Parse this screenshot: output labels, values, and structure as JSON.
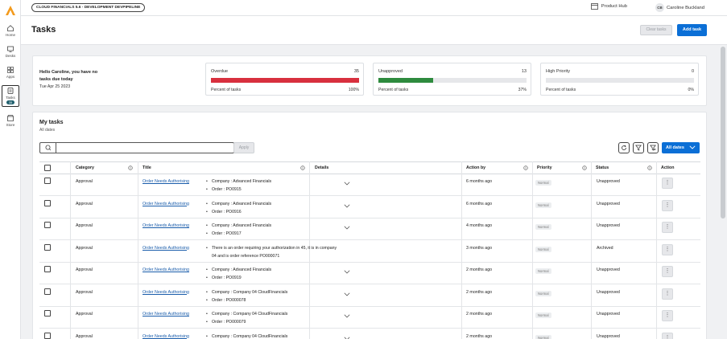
{
  "app": {
    "environment": "CLOUD FINANCIALS 5.6 - DEVELOPMENT DEVPIPELINE",
    "product_hub": "Product Hub",
    "user_initials": "CB",
    "user_name": "Caroline Buckland"
  },
  "rail": {
    "items": [
      {
        "label": "Home",
        "icon": "home-icon"
      },
      {
        "label": "Desks",
        "icon": "desk-icon"
      },
      {
        "label": "Apps",
        "icon": "apps-icon"
      },
      {
        "label": "Tasks",
        "icon": "tasks-icon",
        "badge": "35",
        "active": true
      },
      {
        "label": "Store",
        "icon": "store-icon"
      }
    ]
  },
  "header": {
    "title": "Tasks",
    "clear_tasks": "Clear tasks",
    "add_task": "Add task"
  },
  "summary": {
    "greeting": "Hello Caroline, you have no tasks due today",
    "date": "Tue Apr 25 2023",
    "stats": [
      {
        "label": "Overdue",
        "count": "35",
        "percent_label": "Percent of tasks",
        "percent": "100%",
        "fraction": 1.0,
        "color": "#d8303e"
      },
      {
        "label": "Unapproved",
        "count": "13",
        "percent_label": "Percent of tasks",
        "percent": "37%",
        "fraction": 0.37,
        "color": "#2e8b3e"
      },
      {
        "label": "High Priority",
        "count": "0",
        "percent_label": "Percent of tasks",
        "percent": "0%",
        "fraction": 0.0,
        "color": "#0b6fd6"
      }
    ]
  },
  "tasks": {
    "title": "My tasks",
    "subtitle": "All dates",
    "search_placeholder": "",
    "apply": "Apply",
    "date_filter": "All dates",
    "columns": [
      "Category",
      "Title",
      "Details",
      "Action by",
      "Priority",
      "Status",
      "Action"
    ],
    "rows": [
      {
        "category": "Approval",
        "title": "Order Needs Authorising",
        "details": [
          "Company : Advanced Financials",
          "Order : PO0915"
        ],
        "action_by": "6 months ago",
        "priority": "Normal",
        "status": "Unapproved"
      },
      {
        "category": "Approval",
        "title": "Order Needs Authorising",
        "details": [
          "Company : Advanced Financials",
          "Order : PO0916"
        ],
        "action_by": "6 months ago",
        "priority": "Normal",
        "status": "Unapproved"
      },
      {
        "category": "Approval",
        "title": "Order Needs Authorising",
        "details": [
          "Company : Advanced Financials",
          "Order : PO0917"
        ],
        "action_by": "4 months ago",
        "priority": "Normal",
        "status": "Unapproved"
      },
      {
        "category": "Approval",
        "title": "Order Needs Authorising",
        "details": [
          "There is an order requiring your authorization in 45, it is in company 04 and is order reference PO000071"
        ],
        "action_by": "3 months ago",
        "priority": "Normal",
        "status": "Archived"
      },
      {
        "category": "Approval",
        "title": "Order Needs Authorising",
        "details": [
          "Company : Advanced Financials",
          "Order : PO0919"
        ],
        "action_by": "2 months ago",
        "priority": "Normal",
        "status": "Unapproved"
      },
      {
        "category": "Approval",
        "title": "Order Needs Authorising",
        "details": [
          "Company : Company 04 CloudFinancials",
          "Order : PO000078"
        ],
        "action_by": "2 months ago",
        "priority": "Normal",
        "status": "Unapproved"
      },
      {
        "category": "Approval",
        "title": "Order Needs Authorising",
        "details": [
          "Company : Company 04 CloudFinancials",
          "Order : PO000079"
        ],
        "action_by": "2 months ago",
        "priority": "Normal",
        "status": "Unapproved"
      },
      {
        "category": "Approval",
        "title": "Order Needs Authorising",
        "details": [
          "Company : Company 04 CloudFinancials"
        ],
        "action_by": "2 months ago",
        "priority": "Normal",
        "status": "Unapproved"
      }
    ]
  }
}
